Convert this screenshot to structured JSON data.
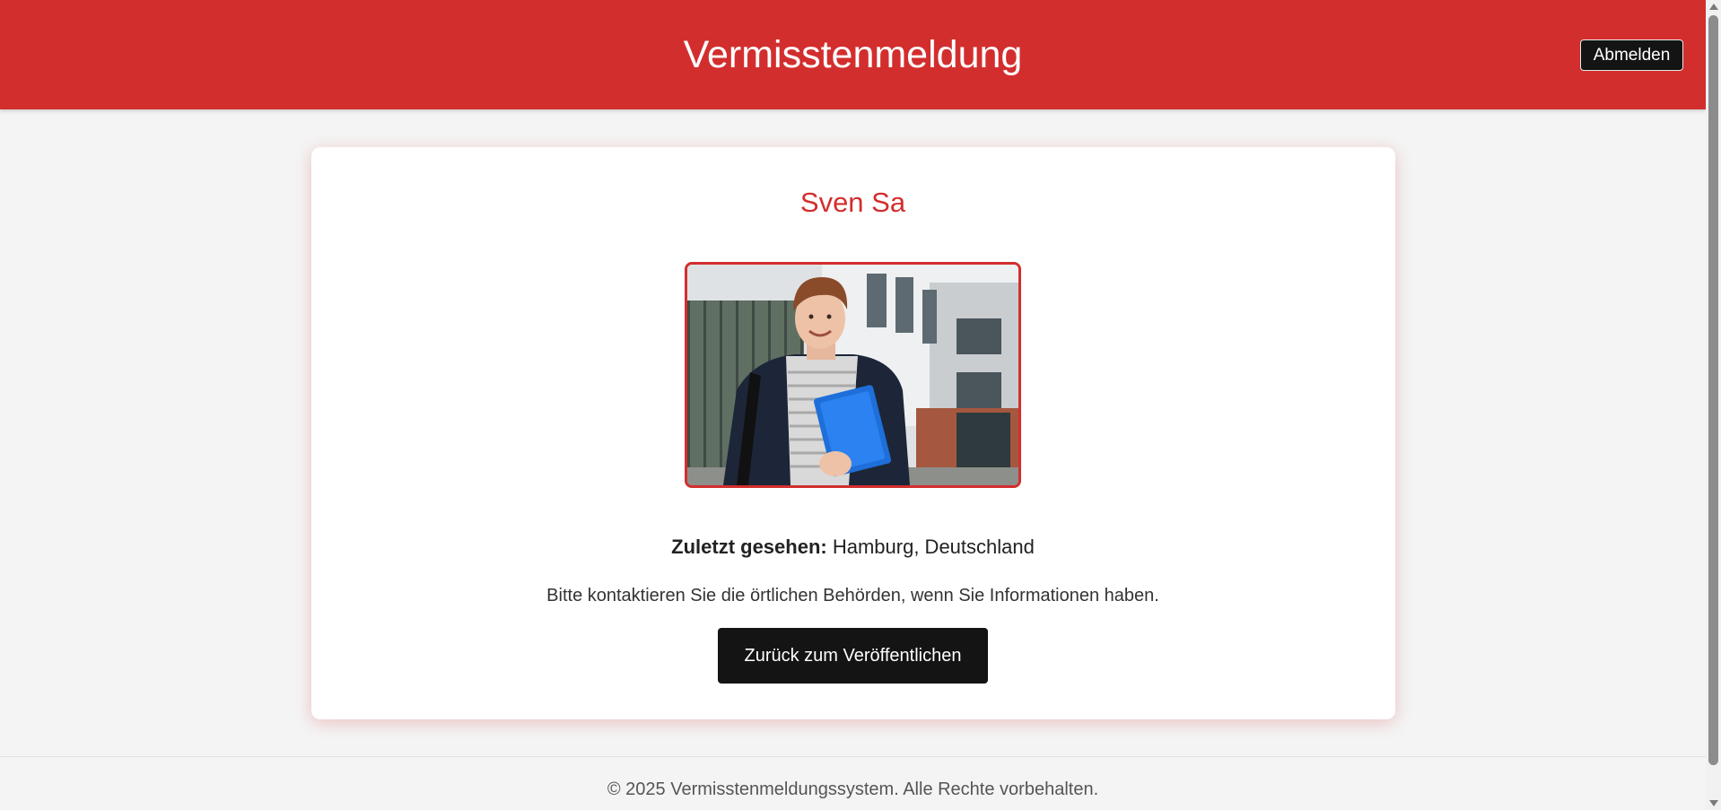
{
  "header": {
    "title": "Vermisstenmeldung",
    "logout_label": "Abmelden",
    "color": "#d32e2e"
  },
  "card": {
    "name": "Sven Sa",
    "photo_icon": "person-photo",
    "last_seen_label": "Zuletzt gesehen:",
    "last_seen_value": "Hamburg, Deutschland",
    "contact_note": "Bitte kontaktieren Sie die örtlichen Behörden, wenn Sie Informationen haben.",
    "back_button_label": "Zurück zum Veröffentlichen"
  },
  "footer": {
    "text": "© 2025 Vermisstenmeldungssystem. Alle Rechte vorbehalten."
  },
  "colors": {
    "accent": "#d32e2e",
    "button_dark": "#141414",
    "background": "#f4f4f4"
  }
}
